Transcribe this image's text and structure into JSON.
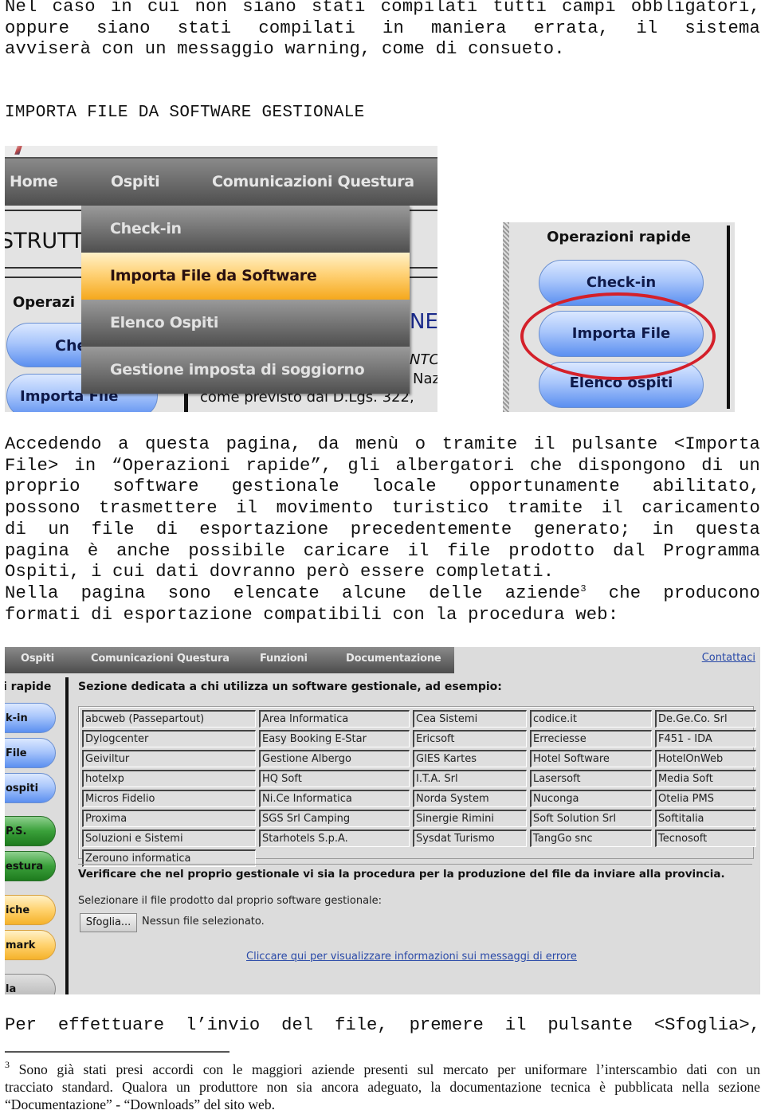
{
  "intro_lines": [
    "Nel caso in cui non siano stati compilati tutti campi obbligatori,",
    "oppure siano stati compilati in maniera errata, il sistema",
    "avviserà con un messaggio warning, come di consueto."
  ],
  "section_heading": "IMPORTA FILE DA SOFTWARE GESTIONALE",
  "screenshot_menu": {
    "nav": [
      "Home",
      "Ospiti",
      "Comunicazioni Questura"
    ],
    "background_title": "STRUTT",
    "background_operazioni": "Operazi",
    "background_buttons": [
      "Che",
      "Importa File"
    ],
    "background_text": [
      "NE",
      "NTC",
      "Naz",
      "come previsto dal D.Lgs. 322,"
    ],
    "dropdown": [
      {
        "label": "Check-in",
        "active": false
      },
      {
        "label": "Importa File da Software Gestionale",
        "active": true
      },
      {
        "label": "Elenco Ospiti",
        "active": false
      },
      {
        "label": "Gestione imposta di soggiorno",
        "active": false
      }
    ]
  },
  "screenshot_quick_ops": {
    "title": "Operazioni rapide",
    "buttons": [
      "Check-in",
      "Importa File",
      "Elenco ospiti"
    ],
    "highlighted": "Importa File",
    "highlight_color": "#d4202a"
  },
  "body_lines": [
    "Accedendo a questa pagina, da menù o tramite il pulsante <Importa",
    "File> in “Operazioni rapide”, gli albergatori che dispongono di un",
    "proprio software gestionale locale opportunamente abilitato,",
    "possono trasmettere il movimento turistico tramite il caricamento",
    "di un file di esportazione precedentemente generato; in questa",
    "pagina è anche possibile caricare il file prodotto dal Programma",
    "Ospiti, i cui dati dovranno però essere completati."
  ],
  "body_line_with_note": {
    "before": "Nella pagina sono elencate alcune delle aziende",
    "note": "3",
    "after": " che producono"
  },
  "body_last_line": "formati di esportazione compatibili con la procedura web:",
  "screenshot_import": {
    "nav": [
      "Ospiti",
      "Comunicazioni Questura",
      "Funzioni",
      "Documentazione"
    ],
    "contact_link": "Contattaci",
    "sidebar_title": "i rapide",
    "sidebar_buttons": [
      {
        "label": "k-in",
        "color": "blue"
      },
      {
        "label": "File",
        "color": "blue"
      },
      {
        "label": "ospiti",
        "color": "blue"
      },
      {
        "label": "P.S.",
        "color": "green"
      },
      {
        "label": "estura",
        "color": "green"
      },
      {
        "label": "iche",
        "color": "orange"
      },
      {
        "label": "mark",
        "color": "orange"
      },
      {
        "label": "la",
        "color": "gray"
      }
    ],
    "section_title": "Sezione dedicata a chi utilizza un software gestionale, ad esempio:",
    "vendors": [
      [
        "abcweb (Passepartout)",
        "Area Informatica",
        "Cea Sistemi",
        "codice.it",
        "De.Ge.Co. Srl"
      ],
      [
        "Dylogcenter",
        "Easy Booking E-Star",
        "Ericsoft",
        "Erreciesse",
        "F451 - IDA"
      ],
      [
        "Geiviltur",
        "Gestione Albergo",
        "GIES Kartes",
        "Hotel Software",
        "HotelOnWeb"
      ],
      [
        "hotelxp",
        "HQ Soft",
        "I.T.A. Srl",
        "Lasersoft",
        "Media Soft"
      ],
      [
        "Micros Fidelio",
        "Ni.Ce Informatica",
        "Norda System",
        "Nuconga",
        "Otelia PMS"
      ],
      [
        "Proxima",
        "SGS Srl Camping",
        "Sinergie Rimini",
        "Soft Solution Srl",
        "Softitalia"
      ],
      [
        "Soluzioni e Sistemi",
        "Starhotels S.p.A.",
        "Sysdat Turismo",
        "TangGo snc",
        "Tecnosoft"
      ],
      [
        "Zerouno informatica"
      ]
    ],
    "verify_text": "Verificare che nel proprio gestionale vi sia la procedura per la produzione del file da inviare alla provincia.",
    "select_label": "Selezionare il file prodotto dal proprio software gestionale:",
    "browse_button": "Sfoglia...",
    "no_file_text": "Nessun file selezionato.",
    "error_link": "Cliccare qui per visualizzare informazioni sui messaggi di errore"
  },
  "bottom_line": "Per effettuare l’invio del file, premere il pulsante <Sfoglia>,",
  "footnote": {
    "number": "3",
    "lines": [
      "Sono già stati presi accordi con le maggiori aziende presenti sul mercato per uniformare l’interscambio dati con un",
      "tracciato standard. Qualora un produttore non sia ancora adeguato, la documentazione tecnica è pubblicata nella sezione",
      "“Documentazione” - “Downloads” del sito web."
    ]
  }
}
